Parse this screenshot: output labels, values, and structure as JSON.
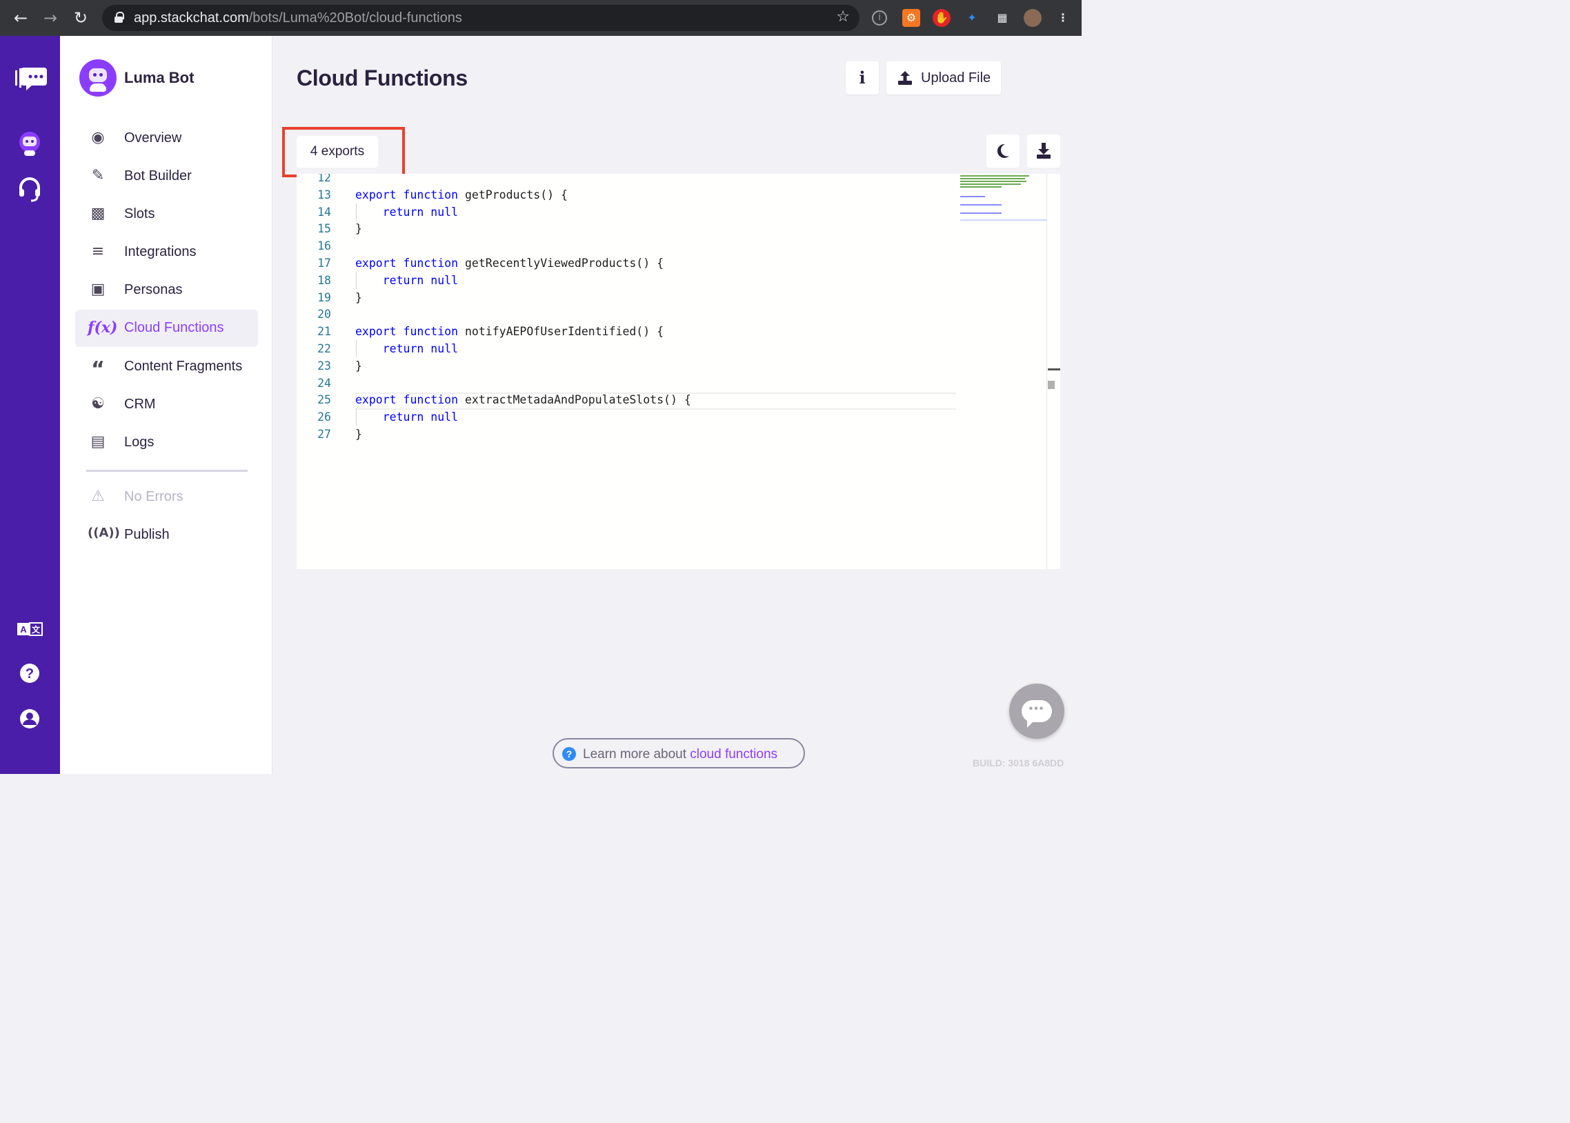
{
  "browser": {
    "url_host": "app.stackchat.com",
    "url_path": "/bots/Luma%20Bot/cloud-functions",
    "icons": [
      "back-icon",
      "forward-icon",
      "reload-icon",
      "lock-icon",
      "bookmark-star-icon",
      "hubspot-extension-icon",
      "adblock-extension-icon",
      "extension-icon",
      "puzzle-icon",
      "profile-avatar",
      "kebab-menu-icon"
    ]
  },
  "rail": {
    "icons": [
      "stackchat-logo-icon",
      "bot-icon",
      "headset-icon",
      "translate-icon",
      "help-icon",
      "account-icon"
    ]
  },
  "sidebar": {
    "bot_name": "Luma Bot",
    "items": [
      {
        "label": "Overview",
        "icon": "eye-icon"
      },
      {
        "label": "Bot Builder",
        "icon": "pencil-icon"
      },
      {
        "label": "Slots",
        "icon": "puzzle-piece-icon"
      },
      {
        "label": "Integrations",
        "icon": "layers-plus-icon"
      },
      {
        "label": "Personas",
        "icon": "id-badge-icon"
      },
      {
        "label": "Cloud Functions",
        "icon": "function-icon",
        "active": true
      },
      {
        "label": "Content Fragments",
        "icon": "quote-icon"
      },
      {
        "label": "CRM",
        "icon": "handshake-icon"
      },
      {
        "label": "Logs",
        "icon": "clipboard-icon"
      }
    ],
    "status": {
      "label": "No Errors",
      "icon": "warning-icon"
    },
    "publish": {
      "label": "Publish",
      "icon": "broadcast-icon"
    }
  },
  "main": {
    "title": "Cloud Functions",
    "upload_label": "Upload File",
    "info_label": "i",
    "exports_label": "4 exports"
  },
  "editor": {
    "lines": [
      {
        "n": "12",
        "text": ""
      },
      {
        "n": "13",
        "text": "export function getProducts() {"
      },
      {
        "n": "14",
        "text": "    return null"
      },
      {
        "n": "15",
        "text": "}"
      },
      {
        "n": "16",
        "text": ""
      },
      {
        "n": "17",
        "text": "export function getRecentlyViewedProducts() {"
      },
      {
        "n": "18",
        "text": "    return null"
      },
      {
        "n": "19",
        "text": "}"
      },
      {
        "n": "20",
        "text": ""
      },
      {
        "n": "21",
        "text": "export function notifyAEPOfUserIdentified() {"
      },
      {
        "n": "22",
        "text": "    return null"
      },
      {
        "n": "23",
        "text": "}"
      },
      {
        "n": "24",
        "text": ""
      },
      {
        "n": "25",
        "text": "export function extractMetadaAndPopulateSlots() {"
      },
      {
        "n": "26",
        "text": "    return null"
      },
      {
        "n": "27",
        "text": "}"
      }
    ]
  },
  "footer": {
    "learn_prefix": "Learn more about ",
    "learn_link": "cloud functions",
    "build": "BUILD: 3018 6A8DD"
  },
  "colors": {
    "brand_purple": "#4a1ea8",
    "accent": "#8b3dff",
    "highlight": "#e8412c",
    "keyword": "#0000ff",
    "line_number": "#237893"
  }
}
